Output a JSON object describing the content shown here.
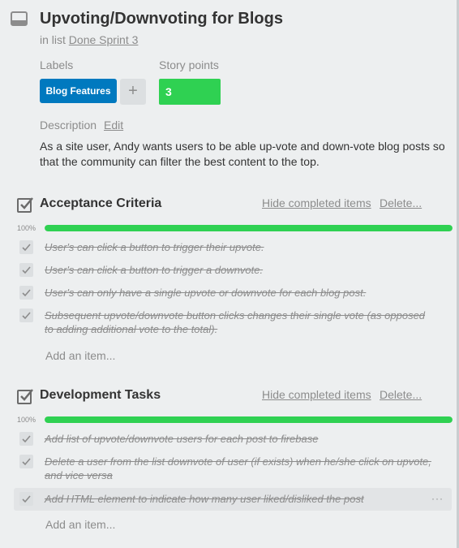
{
  "card": {
    "title": "Upvoting/Downvoting for Blogs",
    "in_list_prefix": "in list",
    "list_name": "Done Sprint 3"
  },
  "labels": {
    "heading": "Labels",
    "items": [
      {
        "text": "Blog Features",
        "color": "#0079bf"
      }
    ],
    "add_symbol": "+"
  },
  "story_points": {
    "heading": "Story points",
    "value": "3",
    "color": "#2fd152"
  },
  "description": {
    "heading": "Description",
    "edit_label": "Edit",
    "text": "As a site user, Andy wants users to be able up-vote and down-vote blog posts so that the community can filter the best content to the top."
  },
  "checklists": [
    {
      "title": "Acceptance Criteria",
      "hide_label": "Hide completed items",
      "delete_label": "Delete...",
      "percent_text": "100%",
      "progress": 1.0,
      "items": [
        {
          "text": "User's can click a button to trigger their upvote.",
          "done": true
        },
        {
          "text": "User's can click a button to trigger a downvote.",
          "done": true
        },
        {
          "text": "User's can only have a single upvote or downvote for each blog post.",
          "done": true
        },
        {
          "text": "Subsequent upvote/downvote button clicks changes their single vote (as opposed to adding additional vote to the total).",
          "done": true
        }
      ],
      "add_item_label": "Add an item..."
    },
    {
      "title": "Development Tasks",
      "hide_label": "Hide completed items",
      "delete_label": "Delete...",
      "percent_text": "100%",
      "progress": 1.0,
      "items": [
        {
          "text": "Add list of upvote/downvote users for each post to firebase",
          "done": true
        },
        {
          "text": "Delete a user from the list downvote of user (if exists) when he/she click on upvote, and vice versa",
          "done": true
        },
        {
          "text": "Add HTML element to indicate how many user liked/disliked the post",
          "done": true
        }
      ],
      "add_item_label": "Add an item...",
      "more_symbol": "···"
    }
  ],
  "icons": {
    "card": "card-icon",
    "checklist": "checklist-icon",
    "check": "check-icon"
  },
  "colors": {
    "progress": "#2fd152",
    "label": "#0079bf",
    "background": "#edeff0"
  }
}
